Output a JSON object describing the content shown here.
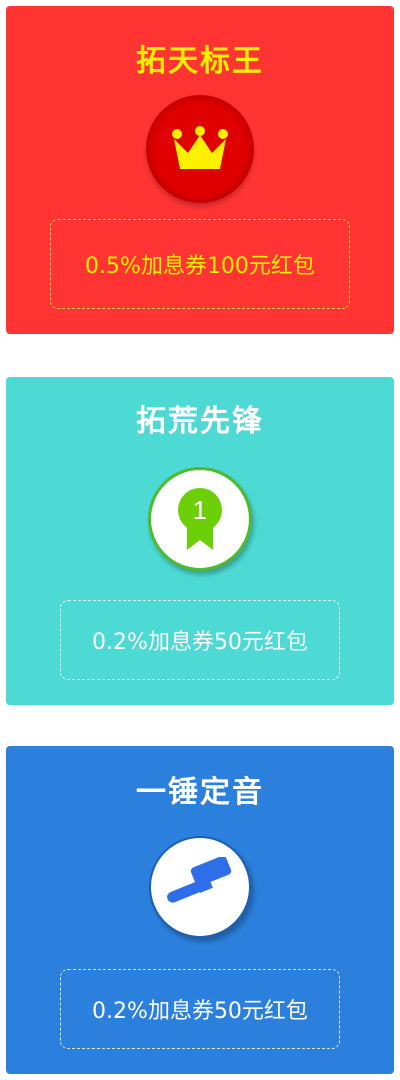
{
  "cards": [
    {
      "title": "拓天标王",
      "icon": "crown-icon",
      "reward": "0.5%加息券100元红包",
      "colors": {
        "background": "#ff3433",
        "title": "#fff000",
        "reward_text": "#fff000",
        "reward_border": "#ffd54a"
      }
    },
    {
      "title": "拓荒先锋",
      "icon": "rank-1-medal-icon",
      "medal_number": "1",
      "reward": "0.2%加息券50元红包",
      "colors": {
        "background": "#4dd9d4",
        "title": "#ffffff",
        "reward_text": "#ffffff",
        "medal": "#6dcf08"
      }
    },
    {
      "title": "一锤定音",
      "icon": "gavel-icon",
      "reward": "0.2%加息券50元红包",
      "colors": {
        "background": "#2a80dc",
        "title": "#ffffff",
        "reward_text": "#ffffff",
        "gavel": "#2e6ee8"
      }
    }
  ]
}
